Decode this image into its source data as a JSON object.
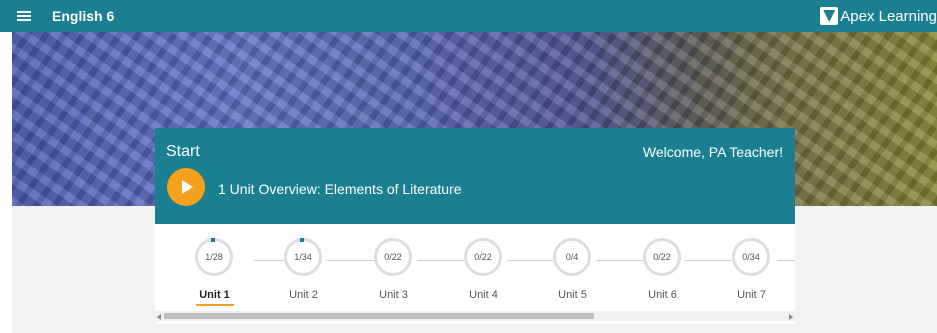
{
  "header": {
    "menu_icon": "hamburger-menu-icon",
    "course_title": "English 6",
    "brand_name": "Apex Learning",
    "accent_color": "#1a8091"
  },
  "start_card": {
    "label": "Start",
    "welcome": "Welcome, PA Teacher!",
    "play_icon": "play-icon",
    "play_color": "#f5a11e",
    "lesson_title": "1 Unit Overview: Elements of Literature"
  },
  "units": [
    {
      "label": "Unit 1",
      "progress": "1/28",
      "active": true
    },
    {
      "label": "Unit 2",
      "progress": "1/34",
      "active": false
    },
    {
      "label": "Unit 3",
      "progress": "0/22",
      "active": false
    },
    {
      "label": "Unit 4",
      "progress": "0/22",
      "active": false
    },
    {
      "label": "Unit 5",
      "progress": "0/4",
      "active": false
    },
    {
      "label": "Unit 6",
      "progress": "0/22",
      "active": false
    },
    {
      "label": "Unit 7",
      "progress": "0/34",
      "active": false
    }
  ]
}
